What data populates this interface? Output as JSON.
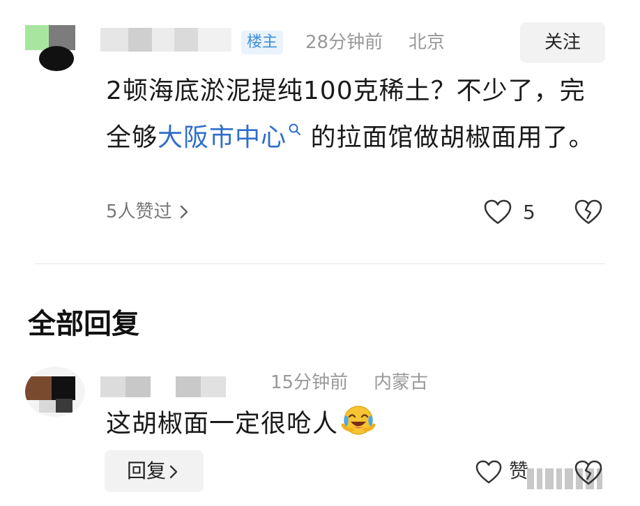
{
  "comment": {
    "op_badge": "楼主",
    "time": "28分钟前",
    "location": "北京",
    "follow_label": "关注",
    "text_before": "2顿海底淤泥提纯100克稀土？不少了，完全够",
    "text_link": "大阪市中心",
    "text_after": "的拉面馆做胡椒面用了。",
    "liked_by": "5人赞过",
    "like_count": "5",
    "icons": {
      "avatar": "avatar",
      "search": "search-icon",
      "chevron": "chevron-right-icon",
      "like": "heart-icon",
      "dislike": "broken-heart-icon"
    }
  },
  "replies_section": {
    "title": "全部回复"
  },
  "reply": {
    "time": "15分钟前",
    "location": "内蒙古",
    "text": "这胡椒面一定很呛人",
    "emoji": "laughing-crying-emoji",
    "reply_label": "回复",
    "like_label": "赞"
  },
  "colors": {
    "link": "#2f6ec9",
    "meta": "#999999",
    "badge_text": "#3f8fd6",
    "button_bg": "#f2f2f2"
  }
}
